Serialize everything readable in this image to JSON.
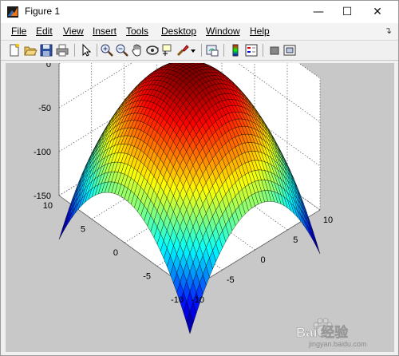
{
  "window": {
    "title": "Figure 1"
  },
  "menu": [
    {
      "id": "file",
      "label": "File"
    },
    {
      "id": "edit",
      "label": "Edit"
    },
    {
      "id": "view",
      "label": "View"
    },
    {
      "id": "insert",
      "label": "Insert"
    },
    {
      "id": "tools",
      "label": "Tools"
    },
    {
      "id": "desktop",
      "label": "Desktop"
    },
    {
      "id": "window",
      "label": "Window"
    },
    {
      "id": "help",
      "label": "Help"
    }
  ],
  "toolbar_icons": [
    "new-figure-icon",
    "open-file-icon",
    "save-icon",
    "print-icon",
    "select-arrow-icon",
    "zoom-in-icon",
    "zoom-out-icon",
    "pan-hand-icon",
    "rotate-3d-icon",
    "data-cursor-icon",
    "brush-icon",
    "brush-dropdown-icon",
    "link-plot-icon",
    "colorbar-icon",
    "legend-icon",
    "hide-plot-tools-icon",
    "show-plot-tools-icon"
  ],
  "chart_data": {
    "type": "surface",
    "function": "z = -(x^2 + y^2)",
    "x": [
      -10,
      10
    ],
    "y": [
      -10,
      10
    ],
    "zlim": [
      -150,
      0
    ],
    "colormap": "jet",
    "z_ticks": [
      "0",
      "-50",
      "-100",
      "-150"
    ],
    "x_ticks": [
      "-10",
      "-5",
      "0",
      "5",
      "10"
    ],
    "y_ticks": [
      "-10",
      "-5",
      "0",
      "5",
      "10"
    ],
    "grid": true,
    "box": false
  },
  "watermark": {
    "brand": "Bai 经验",
    "site": "jingyan.baidu.com"
  }
}
